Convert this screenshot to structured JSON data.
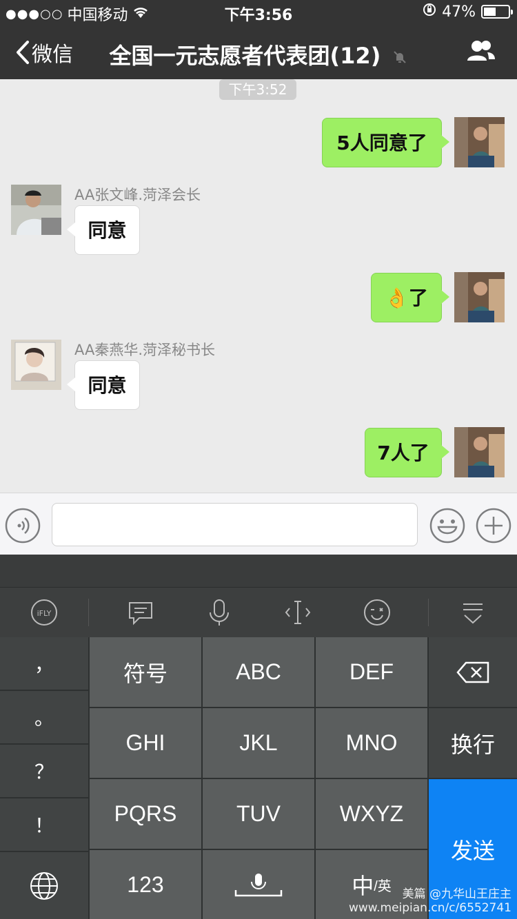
{
  "status_bar": {
    "carrier": "中国移动",
    "signal": "●●●○○",
    "time": "下午3:56",
    "battery": "47%"
  },
  "nav": {
    "back_label": "微信",
    "title": "全国一元志愿者代表团(12)"
  },
  "chat": {
    "timestamp": "下午3:52",
    "messages": [
      {
        "direction": "out",
        "text": "5人同意了"
      },
      {
        "direction": "in",
        "sender": "AA张文峰.菏泽会长",
        "text": "同意"
      },
      {
        "direction": "out",
        "text": "👌了"
      },
      {
        "direction": "in",
        "sender": "AA秦燕华.菏泽秘书长",
        "text": "同意"
      },
      {
        "direction": "out",
        "text": "7人了"
      }
    ]
  },
  "keyboard": {
    "toolbar": [
      "iFLY",
      "message-icon",
      "mic-icon",
      "cursor-icon",
      "emoji-icon",
      "collapse-icon"
    ],
    "left_column": [
      "，",
      "。",
      "？",
      "！"
    ],
    "rows": [
      [
        "符号",
        "ABC",
        "DEF"
      ],
      [
        "GHI",
        "JKL",
        "MNO"
      ],
      [
        "PQRS",
        "TUV",
        "WXYZ"
      ],
      [
        "123",
        "",
        "中"
      ]
    ],
    "en_label": "/英",
    "newline": "换行",
    "send": "发送"
  },
  "watermark": {
    "line1": "美篇 @九华山王庄主",
    "line2": "www.meipian.cn/c/6552741"
  },
  "colors": {
    "nav_bg": "#343434",
    "bubble_out": "#9def63",
    "send_key": "#0e83f4"
  }
}
